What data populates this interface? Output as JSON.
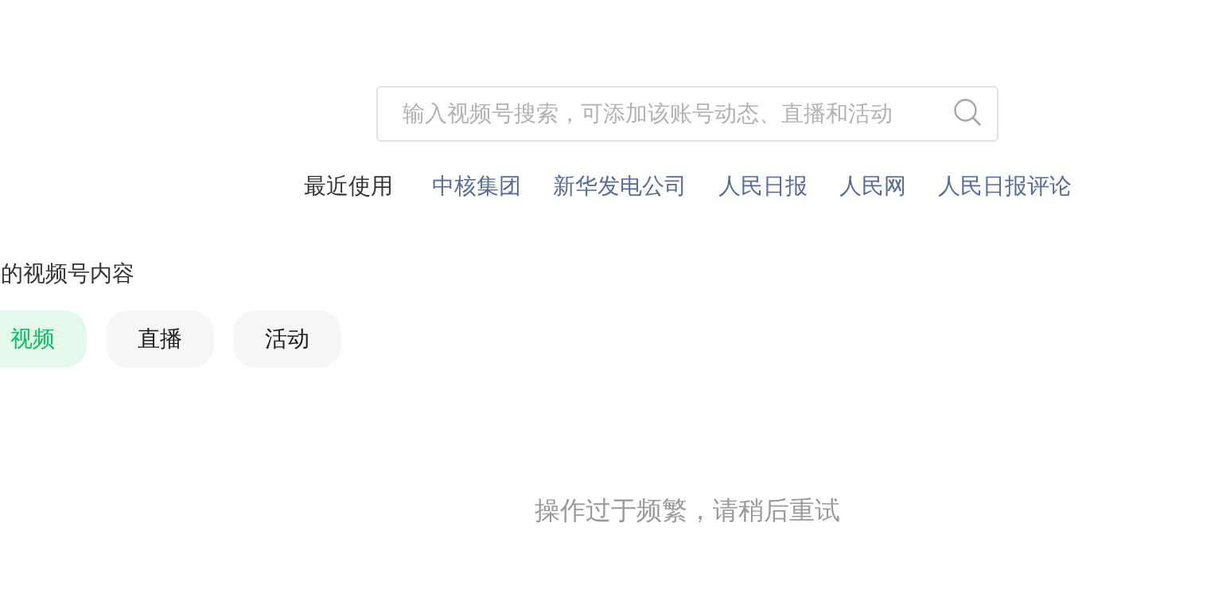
{
  "search": {
    "placeholder": "输入视频号搜索，可添加该账号动态、直播和活动"
  },
  "recent": {
    "label": "最近使用",
    "items": [
      "中核集团",
      "新华发电公司",
      "人民日报",
      "人民网",
      "人民日报评论"
    ]
  },
  "section": {
    "heading": "的视频号内容",
    "tabs": [
      {
        "label": "视频",
        "selected": true
      },
      {
        "label": "直播",
        "selected": false
      },
      {
        "label": "活动",
        "selected": false
      }
    ]
  },
  "message": "操作过于频繁，请稍后重试"
}
